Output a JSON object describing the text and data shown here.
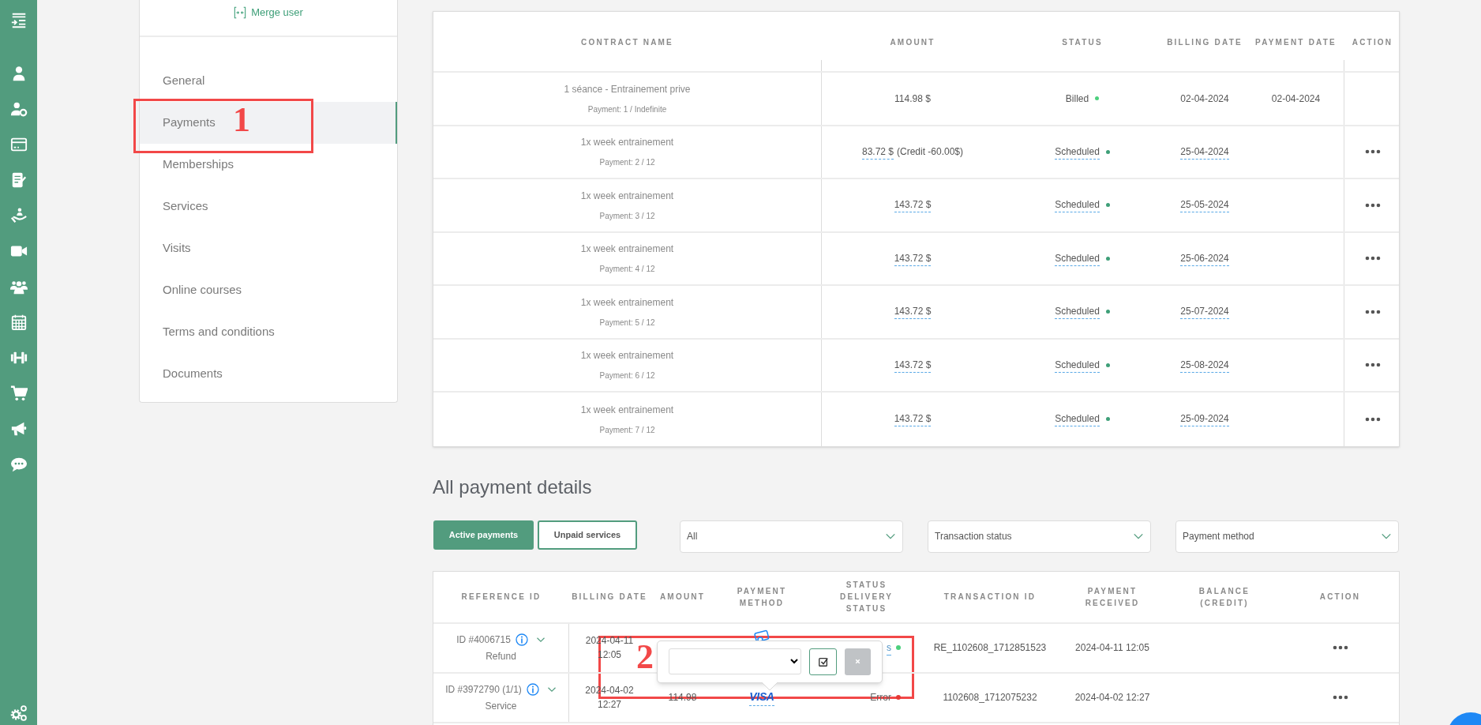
{
  "sidebar": {
    "link": "Merge user",
    "items": [
      {
        "label": "General",
        "selected": false
      },
      {
        "label": "Payments",
        "selected": true
      },
      {
        "label": "Memberships",
        "selected": false
      },
      {
        "label": "Services",
        "selected": false
      },
      {
        "label": "Visits",
        "selected": false
      },
      {
        "label": "Online courses",
        "selected": false
      },
      {
        "label": "Terms and conditions",
        "selected": false
      },
      {
        "label": "Documents",
        "selected": false
      }
    ]
  },
  "contracts_table": {
    "columns": [
      "CONTRACT NAME",
      "AMOUNT",
      "STATUS",
      "BILLING DATE",
      "PAYMENT DATE",
      "ACTION"
    ],
    "rows": [
      {
        "contract": "1 séance - Entrainement prive",
        "installment": "Payment: 1 / Indefinite",
        "amount": "114.98 $",
        "status": "Billed",
        "color": "#4cd07d",
        "billing_date": "02-04-2024",
        "payment_date": "02-04-2024",
        "editable": false
      },
      {
        "contract": "1x week entrainement",
        "installment": "Payment: 2 / 12",
        "amount": "83.72 $",
        "amount_note": "(Credit -60.00$)",
        "status": "Scheduled",
        "color": "#3e9f78",
        "billing_date": "25-04-2024",
        "editable": true
      },
      {
        "contract": "1x week entrainement",
        "installment": "Payment: 3 / 12",
        "amount": "143.72 $",
        "status": "Scheduled",
        "color": "#3e9f78",
        "billing_date": "25-05-2024",
        "editable": true
      },
      {
        "contract": "1x week entrainement",
        "installment": "Payment: 4 / 12",
        "amount": "143.72 $",
        "status": "Scheduled",
        "color": "#3e9f78",
        "billing_date": "25-06-2024",
        "editable": true
      },
      {
        "contract": "1x week entrainement",
        "installment": "Payment: 5 / 12",
        "amount": "143.72 $",
        "status": "Scheduled",
        "color": "#3e9f78",
        "billing_date": "25-07-2024",
        "editable": true
      },
      {
        "contract": "1x week entrainement",
        "installment": "Payment: 6 / 12",
        "amount": "143.72 $",
        "status": "Scheduled",
        "color": "#3e9f78",
        "billing_date": "25-08-2024",
        "editable": true
      },
      {
        "contract": "1x week entrainement",
        "installment": "Payment: 7 / 12",
        "amount": "143.72 $",
        "status": "Scheduled",
        "color": "#3e9f78",
        "billing_date": "25-09-2024",
        "editable": true
      }
    ]
  },
  "payment_details": {
    "title": "All payment details",
    "tabs": [
      {
        "label": "Active payments",
        "selected": true
      },
      {
        "label": "Unpaid services",
        "selected": false
      }
    ],
    "filters": [
      {
        "label": "All"
      },
      {
        "label": "Transaction status"
      },
      {
        "label": "Payment method"
      }
    ],
    "table": {
      "columns": [
        "REFERENCE ID",
        "BILLING DATE",
        "AMOUNT",
        "PAYMENT METHOD",
        "STATUS DELIVERY STATUS",
        "TRANSACTION ID",
        "PAYMENT RECEIVED",
        "BALANCE (CREDIT)",
        "ACTION"
      ],
      "rows": [
        {
          "reference": "ID #4006715",
          "type": "Refund",
          "billing_date": "2024-04-11 12:05",
          "method": {
            "kind": "icon"
          },
          "status": "s",
          "status_editable": true,
          "color": "#4cd07d",
          "transaction_id": "RE_1102608_1712851523",
          "payment_received": "2024-04-11 12:05"
        },
        {
          "reference": "ID #3972790 (1/1)",
          "type": "Service",
          "billing_date": "2024-04-02 12:27",
          "amount": "114.98",
          "method": {
            "kind": "logo",
            "label": "VISA"
          },
          "status": "Error",
          "status_editable": false,
          "color": "#e53935",
          "transaction_id": "1102608_1712075232",
          "payment_received": "2024-04-02 12:27"
        }
      ]
    }
  },
  "annotations": [
    {
      "label": "1"
    },
    {
      "label": "2"
    }
  ]
}
